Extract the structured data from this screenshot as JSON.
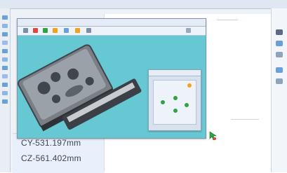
{
  "coordinates": {
    "cy": "CY-531.197mm",
    "cz": "CZ-561.402mm"
  },
  "colors": {
    "viewport_background": "#66c8d2",
    "accent_green": "#2fa341",
    "accent_orange": "#f3a21b",
    "accent_red": "#e0483c"
  },
  "icons": {
    "viewer_toolbar": [
      "open-icon",
      "save-icon",
      "zoom-icon",
      "rotate-icon",
      "view-icon",
      "settings-icon",
      "help-icon"
    ],
    "right_toolbar": [
      "tool-icon-1",
      "tool-icon-2",
      "tool-icon-3",
      "tool-icon-4",
      "tool-icon-5"
    ]
  }
}
